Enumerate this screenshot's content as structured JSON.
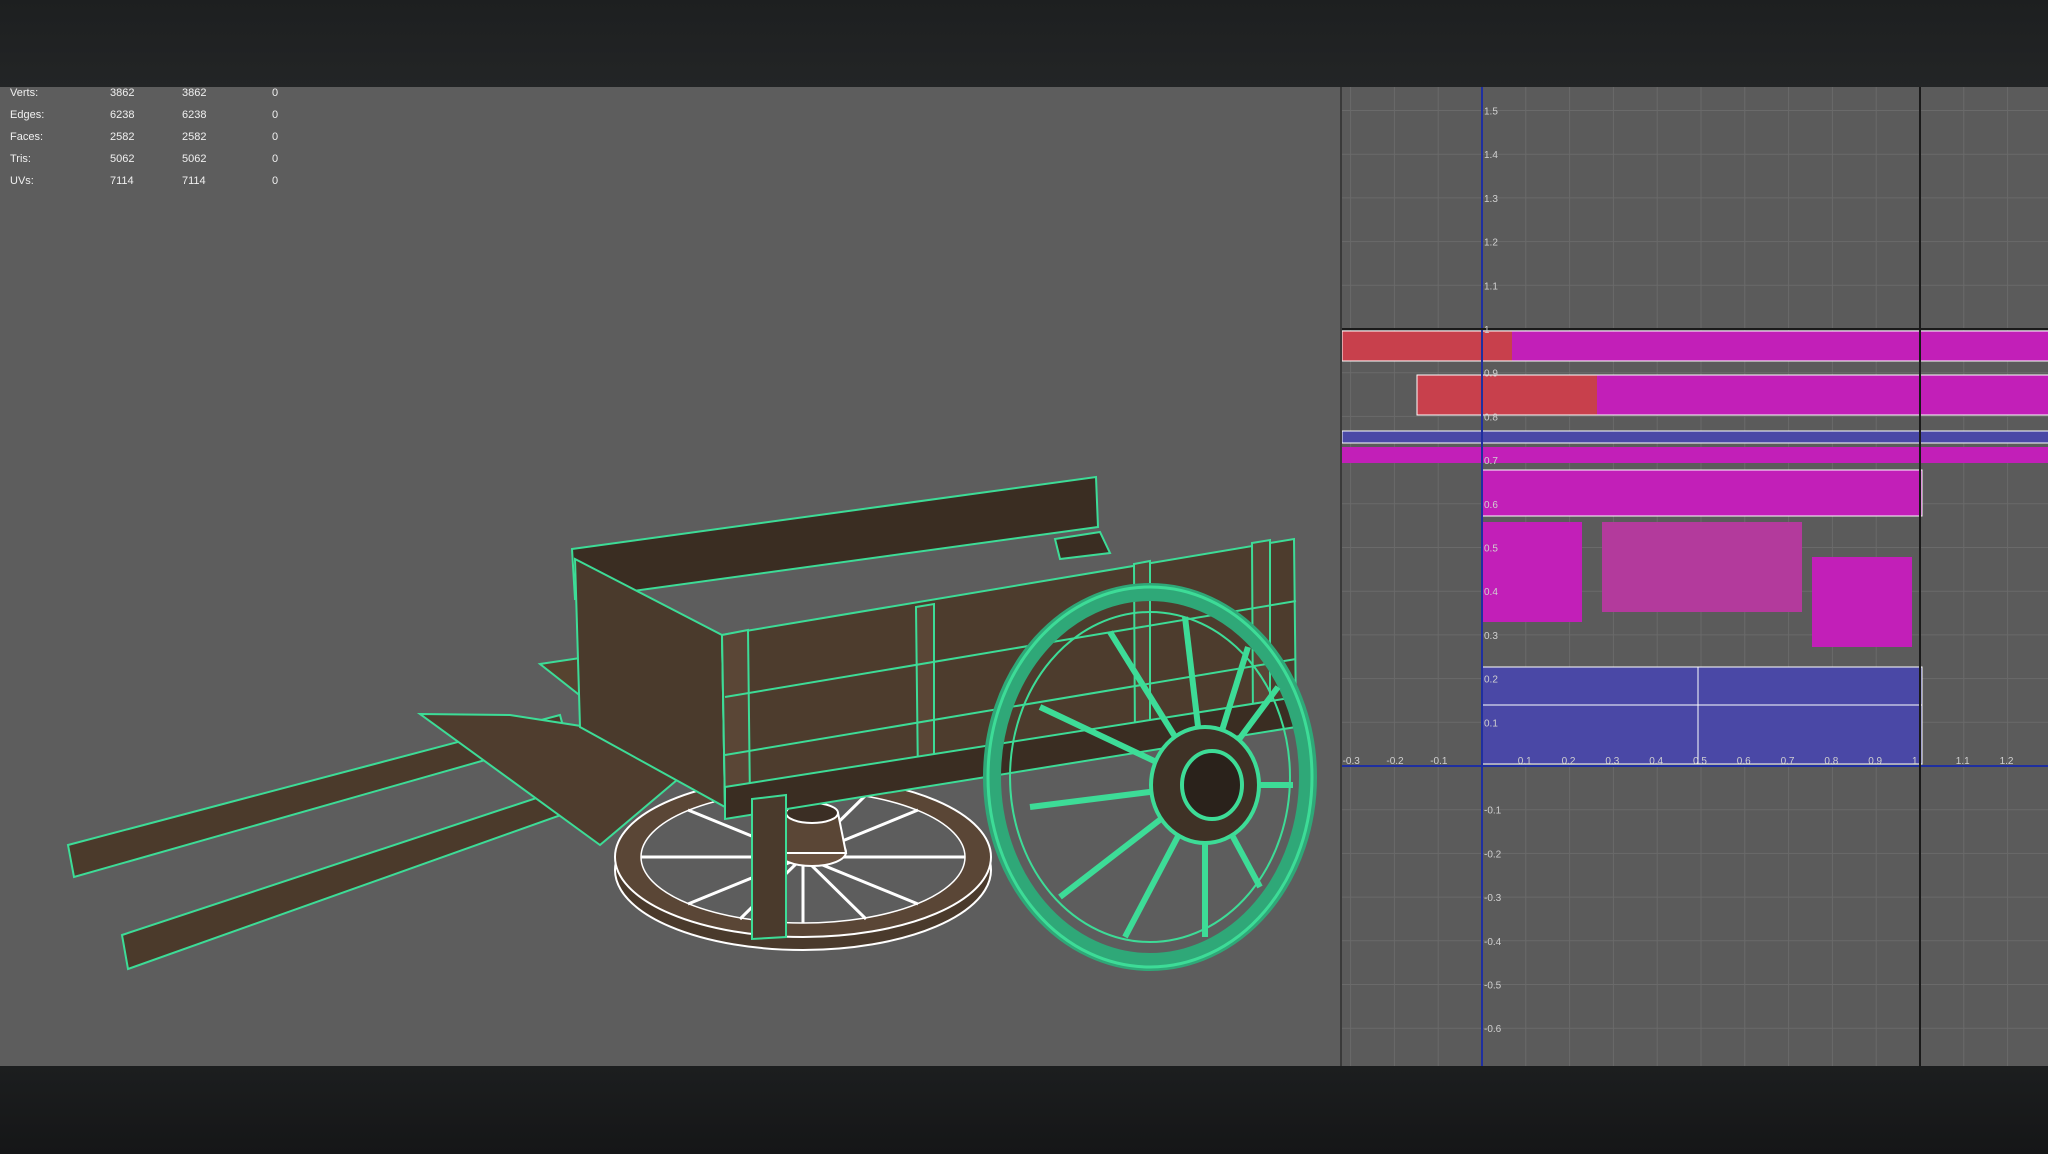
{
  "stats": {
    "rows": [
      {
        "label": "Verts:",
        "total": "3862",
        "selected": "3862",
        "extra": "0"
      },
      {
        "label": "Edges:",
        "total": "6238",
        "selected": "6238",
        "extra": "0"
      },
      {
        "label": "Faces:",
        "total": "2582",
        "selected": "2582",
        "extra": "0"
      },
      {
        "label": "Tris:",
        "total": "5062",
        "selected": "5062",
        "extra": "0"
      },
      {
        "label": "UVs:",
        "total": "7114",
        "selected": "7114",
        "extra": "0"
      }
    ]
  },
  "uv_editor": {
    "v_ticks": [
      "1.5",
      "1.4",
      "1.3",
      "1.2",
      "1.1",
      "1",
      "0.9",
      "0.8",
      "0.7",
      "0.6",
      "0.5",
      "0.4",
      "0.3",
      "0.2",
      "0.1",
      "-0.1",
      "-0.2",
      "-0.3",
      "-0.4",
      "-0.5",
      "-0.6"
    ],
    "u_ticks": [
      "-0.3",
      "-0.2",
      "-0.1",
      "0.1",
      "0.2",
      "0.3",
      "0.4",
      "0.5",
      "0.6",
      "0.7",
      "0.8",
      "0.9",
      "1",
      "1.1",
      "1.2"
    ]
  },
  "colors": {
    "wireframe": "#3ddc97",
    "selected_wire": "#ffffff",
    "wood": "#4a3a2c",
    "uv_magenta": "#c21fb8",
    "uv_red": "#c8404c",
    "uv_blue": "#4a48a6"
  }
}
